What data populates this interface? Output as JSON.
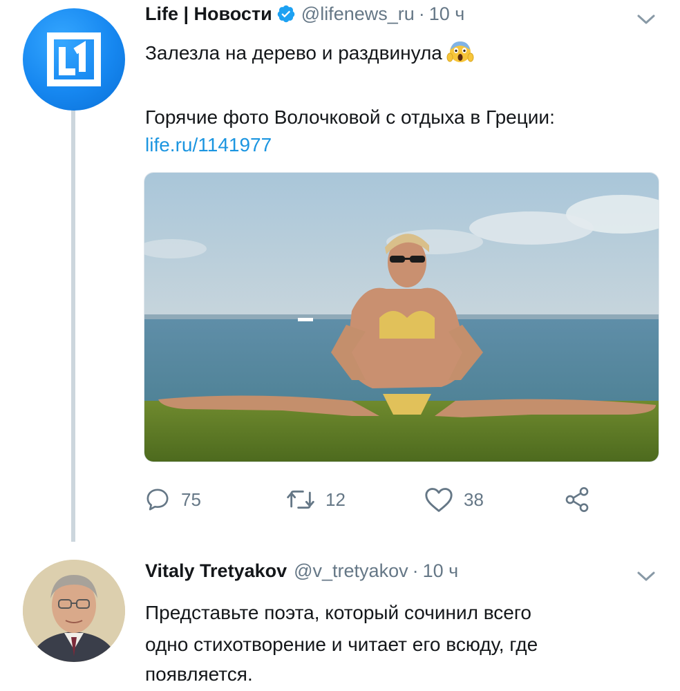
{
  "tweet1": {
    "name": "Life | Новости",
    "handle": "@lifenews_ru",
    "dot": "·",
    "time": "10 ч",
    "text_line1": "Залезла на дерево и раздвинула",
    "text_line2": "Горячие фото Волочковой с отдыха в Греции:",
    "link": "life.ru/1141977",
    "emoji": "scream-emoji",
    "avatar_icon": "life-logo-icon",
    "actions": {
      "reply_count": "75",
      "retweet_count": "12",
      "like_count": "38"
    }
  },
  "tweet2": {
    "name": "Vitaly Tretyakov",
    "handle": "@v_tretyakov",
    "dot": "·",
    "time": "10 ч",
    "text_line1": "Представьте поэта, который сочинил всего",
    "text_line2": "одно стихотворение и читает его всюду, где",
    "text_line3": "появляется."
  },
  "colors": {
    "text": "#14171a",
    "secondary": "#657786",
    "link": "#1b95e0",
    "verified": "#1da1f2",
    "thread_line": "#ccd6dd",
    "life_blue": "#1687f0"
  }
}
